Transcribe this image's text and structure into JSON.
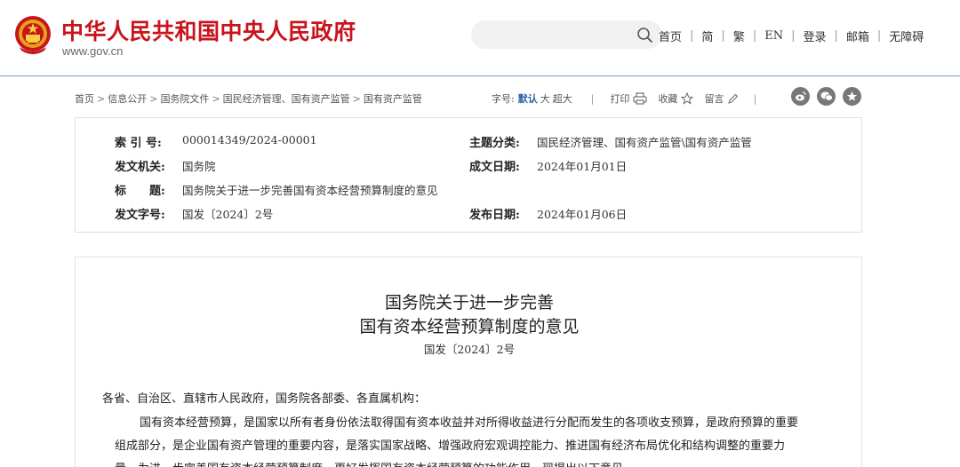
{
  "header": {
    "site_title": "中华人民共和国中央人民政府",
    "site_url": "www.gov.cn",
    "nav": [
      "首页",
      "简",
      "繁",
      "EN",
      "登录",
      "邮箱",
      "无障碍"
    ]
  },
  "breadcrumb": [
    "首页",
    "信息公开",
    "国务院文件",
    "国民经济管理、国有资产监管",
    "国有资产监管"
  ],
  "toolbar": {
    "font_size_label": "字号:",
    "font_default": "默认",
    "font_large": "大",
    "font_xlarge": "超大",
    "print": "打印",
    "favorite": "收藏",
    "comment": "留言"
  },
  "meta": {
    "index_label": "索 引 号:",
    "index_value": "000014349/2024-00001",
    "topic_label": "主题分类:",
    "topic_value": "国民经济管理、国有资产监管\\国有资产监管",
    "issuer_label": "发文机关:",
    "issuer_value": "国务院",
    "written_label": "成文日期:",
    "written_value": "2024年01月01日",
    "title_label": "标　　题:",
    "title_value": "国务院关于进一步完善国有资本经营预算制度的意见",
    "docno_label": "发文字号:",
    "docno_value": "国发〔2024〕2号",
    "published_label": "发布日期:",
    "published_value": "2024年01月06日"
  },
  "article": {
    "title_line1": "国务院关于进一步完善",
    "title_line2": "国有资本经营预算制度的意见",
    "doc_number": "国发〔2024〕2号",
    "salutation": "各省、自治区、直辖市人民政府，国务院各部委、各直属机构：",
    "body_line1": "国有资本经营预算，是国家以所有者身份依法取得国有资本收益并对所得收益进行分配而发生的各项收支预算，是政府预算的重要",
    "body_line2": "组成部分，是企业国有资产管理的重要内容，是落实国家战略、增强政府宏观调控能力、推进国有经济布局优化和结构调整的重要力",
    "body_line3": "量。为进一步完善国有资本经营预算制度，更好发挥国有资本经营预算的功能作用，现提出以下意见。"
  },
  "colors": {
    "brand_red": "#c8141c",
    "link_blue": "#2c63a8",
    "header_rule": "#7f9dbb"
  }
}
